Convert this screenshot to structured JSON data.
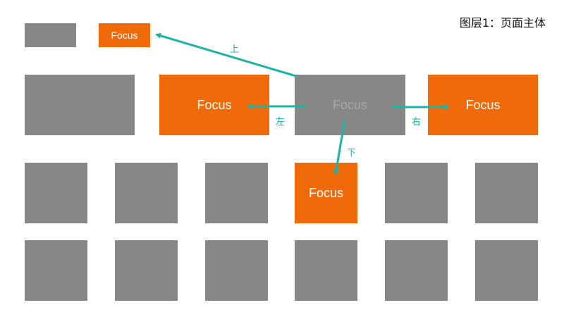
{
  "layer_label": "图层1：页面主体",
  "focus_label": "Focus",
  "directions": {
    "up": "上",
    "down": "下",
    "left": "左",
    "right": "右"
  },
  "colors": {
    "tile": "#878787",
    "focus": "#f06a0a",
    "arrow": "#1ab3a6"
  }
}
